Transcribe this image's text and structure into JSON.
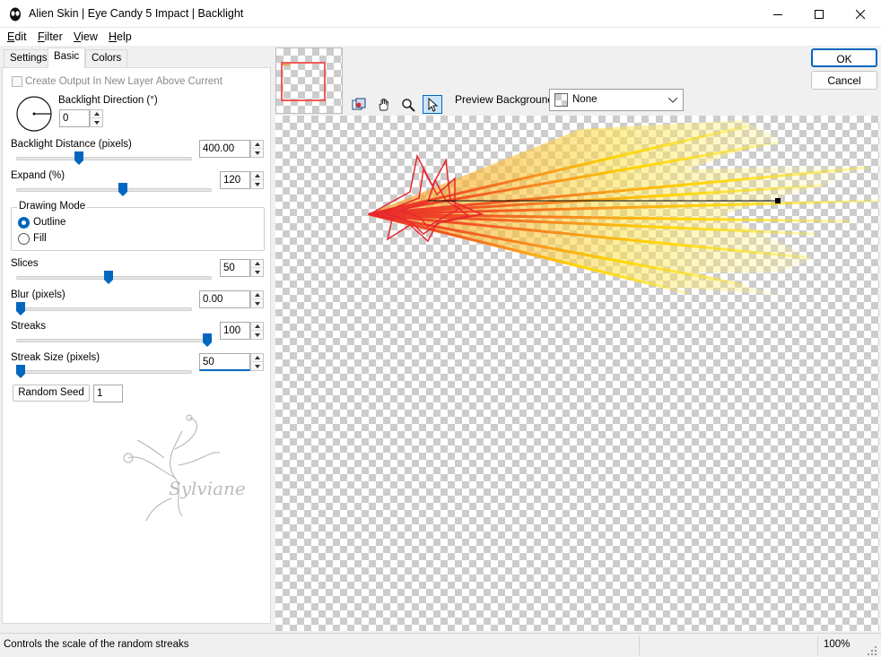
{
  "window": {
    "title": "Alien Skin | Eye Candy 5 Impact | Backlight",
    "app_icon": "alien-head-icon"
  },
  "menu": [
    {
      "label": "Edit",
      "mnemonic": "E",
      "rest": "dit"
    },
    {
      "label": "Filter",
      "mnemonic": "F",
      "rest": "ilter"
    },
    {
      "label": "View",
      "mnemonic": "V",
      "rest": "iew"
    },
    {
      "label": "Help",
      "mnemonic": "H",
      "rest": "elp"
    }
  ],
  "tabs": {
    "settings": "Settings",
    "basic": "Basic",
    "colors": "Colors",
    "active": "Basic"
  },
  "basic": {
    "create_output_label": "Create Output In New Layer Above Current",
    "create_output_checked": false,
    "direction_label": "Backlight Direction (°)",
    "direction_value": "0",
    "distance_label": "Backlight Distance (pixels)",
    "distance_value": "400.00",
    "distance_level": 0.35,
    "expand_label": "Expand (%)",
    "expand_value": "120",
    "expand_level": 0.55,
    "drawing_mode_label": "Drawing Mode",
    "outline_label": "Outline",
    "fill_label": "Fill",
    "drawing_mode_selected": "Outline",
    "slices_label": "Slices",
    "slices_value": "50",
    "slices_level": 0.47,
    "blur_label": "Blur (pixels)",
    "blur_value": "0.00",
    "blur_level": 0.0,
    "streaks_label": "Streaks",
    "streaks_value": "100",
    "streaks_level": 1.0,
    "streak_size_label": "Streak Size (pixels)",
    "streak_size_value": "50",
    "streak_size_level": 0.0,
    "random_seed_label": "Random Seed",
    "random_seed_value": "1",
    "watermark_text": "Sylviane"
  },
  "toolbar": {
    "tools": [
      "pan-preview-icon",
      "hand-icon",
      "zoom-icon",
      "pointer-icon"
    ],
    "active_tool": "pointer-icon",
    "preview_bg_label": "Preview Background:",
    "preview_bg_value": "None"
  },
  "buttons": {
    "ok": "OK",
    "cancel": "Cancel"
  },
  "status": {
    "message": "Controls the scale of the random streaks",
    "zoom": "100%"
  },
  "colors": {
    "accent": "#0067c0",
    "streak_red": "#e8262d",
    "streak_orange": "#f7941d",
    "streak_yellow": "#ffe600"
  }
}
